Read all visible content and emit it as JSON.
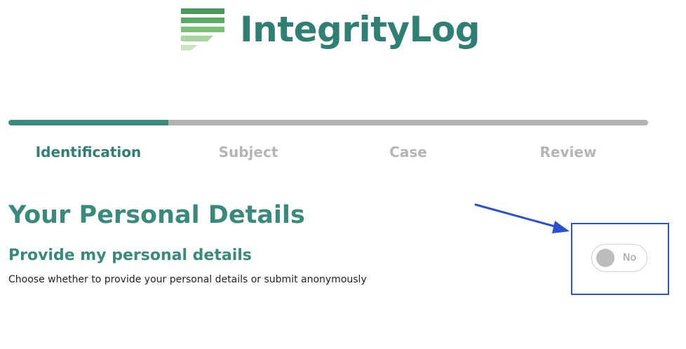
{
  "brand": {
    "name": "IntegrityLog",
    "color": "#2f7f74"
  },
  "progress": {
    "fraction": 0.25,
    "fill_color": "#3a8a7c",
    "track_color": "#b3b3b3"
  },
  "steps": [
    {
      "label": "Identification",
      "active": true
    },
    {
      "label": "Subject",
      "active": false
    },
    {
      "label": "Case",
      "active": false
    },
    {
      "label": "Review",
      "active": false
    }
  ],
  "section": {
    "title": "Your Personal Details",
    "field_label": "Provide my personal details",
    "field_help": "Choose whether to provide your personal details or submit anonymously"
  },
  "toggle": {
    "state_label": "No",
    "checked": false
  },
  "annotation": {
    "color": "#2952cc",
    "icon": "arrow-icon"
  }
}
